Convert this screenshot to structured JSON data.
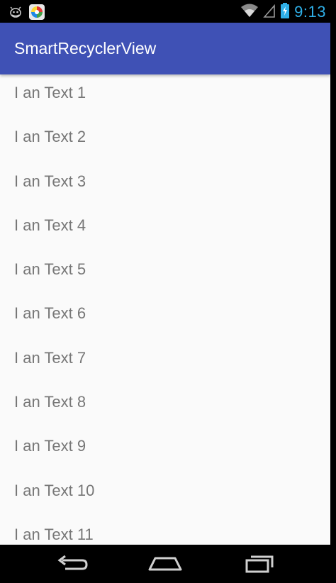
{
  "status_bar": {
    "time": "9:13",
    "time_color": "#2fb0e8",
    "icons": [
      "android-debug-icon",
      "app-notification-icon",
      "wifi-icon",
      "signal-icon",
      "battery-charging-icon"
    ]
  },
  "app_bar": {
    "title": "SmartRecyclerView",
    "color": "#3f51b5"
  },
  "list": {
    "items": [
      "I an Text 1",
      "I an Text 2",
      "I an Text 3",
      "I an Text 4",
      "I an Text 5",
      "I an Text 6",
      "I an Text 7",
      "I an Text 8",
      "I an Text 9",
      "I an Text 10",
      "I an Text 11"
    ]
  },
  "nav_bar": {
    "buttons": [
      "back-icon",
      "home-icon",
      "recents-icon"
    ]
  }
}
